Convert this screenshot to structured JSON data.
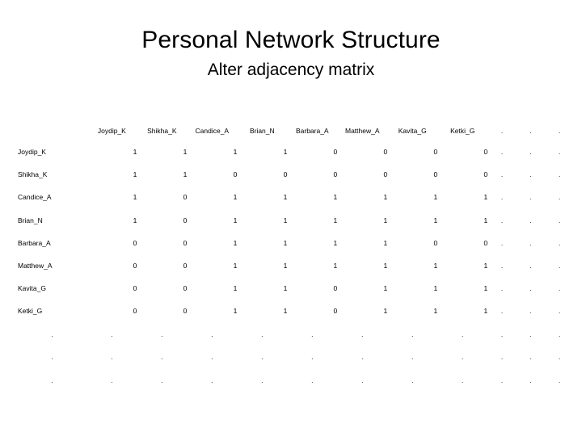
{
  "slide": {
    "title": "Personal Network Structure",
    "subtitle": "Alter adjacency matrix"
  },
  "matrix": {
    "corner_label": "",
    "ellipsis_mark": ".",
    "ellipsis_column_count": 3,
    "ellipsis_row_count": 3,
    "columns": [
      "Joydip_K",
      "Shikha_K",
      "Candice_A",
      "Brian_N",
      "Barbara_A",
      "Matthew_A",
      "Kavita_G",
      "Ketki_G"
    ],
    "rows": [
      {
        "label": "Joydip_K",
        "values": [
          "1",
          "1",
          "1",
          "1",
          "0",
          "0",
          "0",
          "0"
        ]
      },
      {
        "label": "Shikha_K",
        "values": [
          "1",
          "1",
          "0",
          "0",
          "0",
          "0",
          "0",
          "0"
        ]
      },
      {
        "label": "Candice_A",
        "values": [
          "1",
          "0",
          "1",
          "1",
          "1",
          "1",
          "1",
          "1"
        ]
      },
      {
        "label": "Brian_N",
        "values": [
          "1",
          "0",
          "1",
          "1",
          "1",
          "1",
          "1",
          "1"
        ]
      },
      {
        "label": "Barbara_A",
        "values": [
          "0",
          "0",
          "1",
          "1",
          "1",
          "1",
          "0",
          "0"
        ]
      },
      {
        "label": "Matthew_A",
        "values": [
          "0",
          "0",
          "1",
          "1",
          "1",
          "1",
          "1",
          "1"
        ]
      },
      {
        "label": "Kavita_G",
        "values": [
          "0",
          "0",
          "1",
          "1",
          "0",
          "1",
          "1",
          "1"
        ]
      },
      {
        "label": "Ketki_G",
        "values": [
          "0",
          "0",
          "1",
          "1",
          "0",
          "1",
          "1",
          "1"
        ]
      }
    ]
  },
  "colors": {
    "background": "#ffffff",
    "text": "#000000"
  }
}
